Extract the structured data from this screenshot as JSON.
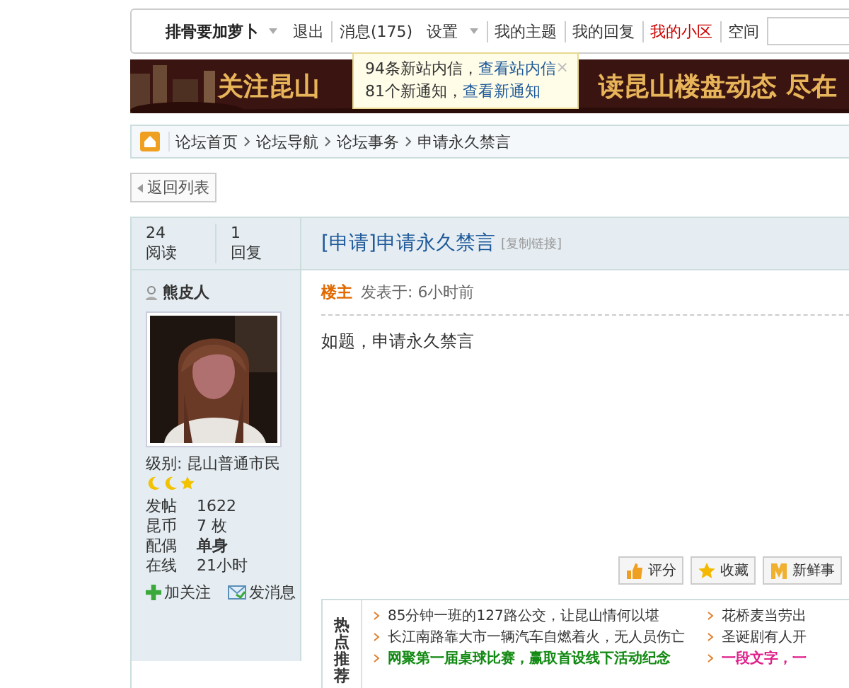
{
  "top_bar": {
    "username": "排骨要加萝卜",
    "items": [
      {
        "label": "退出",
        "kind": "plain"
      },
      {
        "label": "消息(175)",
        "kind": "plain"
      },
      {
        "label": "设置",
        "kind": "dropdown"
      },
      {
        "label": "我的主题",
        "kind": "plain"
      },
      {
        "label": "我的回复",
        "kind": "plain"
      },
      {
        "label": "我的小区",
        "kind": "hot"
      },
      {
        "label": "空间",
        "kind": "plain"
      }
    ]
  },
  "notice_popup": {
    "lines": [
      {
        "text": "94条新站内信，",
        "link": "查看站内信"
      },
      {
        "text": "81个新通知，",
        "link": "查看新通知"
      }
    ],
    "close": "×"
  },
  "banner": {
    "texts": [
      "关注昆山",
      "读昆山楼盘动态 尽在"
    ]
  },
  "breadcrumb": [
    "论坛首页",
    "论坛导航",
    "论坛事务",
    "申请永久禁言"
  ],
  "back_button": "返回列表",
  "thread": {
    "stats": [
      {
        "value": "24",
        "label": "阅读"
      },
      {
        "value": "1",
        "label": "回复"
      }
    ],
    "title": "[申请]申请永久禁言",
    "copy_link": "[复制链接]"
  },
  "author": {
    "name": "熊皮人",
    "level": "级别: 昆山普通市民",
    "rank_icons": [
      {
        "kind": "moon"
      },
      {
        "kind": "moon"
      },
      {
        "kind": "star"
      }
    ],
    "profile": [
      {
        "label": "发帖",
        "value": "1622",
        "kind": "plain"
      },
      {
        "label": "昆币",
        "value": "7 枚",
        "kind": "plain"
      },
      {
        "label": "配偶",
        "value": "单身",
        "kind": "bold"
      },
      {
        "label": "在线",
        "value": "21小时",
        "kind": "plain"
      }
    ],
    "actions": [
      {
        "label": "加关注",
        "kind": "follow"
      },
      {
        "label": "发消息",
        "kind": "message"
      }
    ]
  },
  "post": {
    "role": "楼主",
    "time": "发表于: 6小时前",
    "body": "如题，申请永久禁言",
    "buttons": [
      {
        "label": "评分",
        "kind": "thumb"
      },
      {
        "label": "收藏",
        "kind": "star"
      },
      {
        "label": "新鲜事",
        "kind": "news"
      }
    ]
  },
  "hot_topics": {
    "label": "热点推荐",
    "left": [
      {
        "text": "85分钟一班的127路公交，让昆山情何以堪",
        "kind": "plain"
      },
      {
        "text": "长江南路靠大市一辆汽车自燃着火，无人员伤亡",
        "kind": "plain"
      },
      {
        "text": "网聚第一届桌球比赛，赢取首设线下活动纪念",
        "kind": "green"
      }
    ],
    "right": [
      {
        "text": "花桥麦当劳出",
        "kind": "plain"
      },
      {
        "text": "圣诞剧有人开",
        "kind": "plain"
      },
      {
        "text": "一段文字，一",
        "kind": "pink"
      }
    ]
  }
}
